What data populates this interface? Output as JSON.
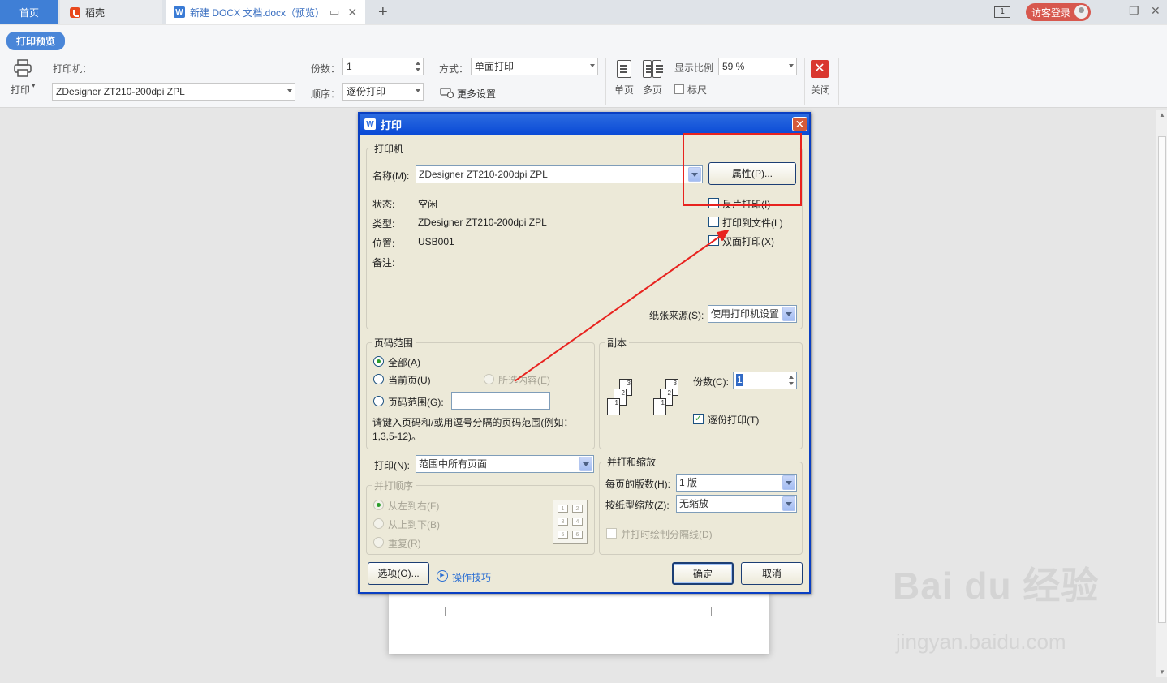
{
  "tabs": {
    "home": "首页",
    "daoke": "稻壳",
    "doc": "新建 DOCX 文档.docx（预览）",
    "new_tab": "+"
  },
  "topright": {
    "window_count": "1",
    "login": "访客登录"
  },
  "toolbar": {
    "preview_badge": "打印预览",
    "print_label": "打印",
    "printer_label": "打印机：",
    "printer_value": "ZDesigner ZT210-200dpi ZPL",
    "copies_label": "份数：",
    "copies_value": "1",
    "order_label": "顺序：",
    "order_value": "逐份打印",
    "mode_label": "方式：",
    "mode_value": "单面打印",
    "more_settings": "更多设置",
    "single_page": "单页",
    "multi_page": "多页",
    "zoom_label": "显示比例",
    "zoom_value": "59 %",
    "ruler": "标尺",
    "close": "关闭"
  },
  "dialog": {
    "title": "打印",
    "printer_group": "打印机",
    "name_label": "名称(M):",
    "name_value": "ZDesigner ZT210-200dpi ZPL",
    "properties_btn": "属性(P)...",
    "status_label": "状态:",
    "status_value": "空闲",
    "type_label": "类型:",
    "type_value": "ZDesigner ZT210-200dpi ZPL",
    "location_label": "位置:",
    "location_value": "USB001",
    "comment_label": "备注:",
    "reverse_print": "反片打印(I)",
    "print_to_file": "打印到文件(L)",
    "duplex": "双面打印(X)",
    "paper_source_label": "纸张来源(S):",
    "paper_source_value": "使用打印机设置",
    "page_range_group": "页码范围",
    "all": "全部(A)",
    "current_page": "当前页(U)",
    "selection": "所选内容(E)",
    "page_range": "页码范围(G):",
    "hint": "请键入页码和/或用逗号分隔的页码范围(例如：1,3,5-12)。",
    "copies_group": "副本",
    "copies_label": "份数(C):",
    "copies_value": "1",
    "collate": "逐份打印(T)",
    "print_label": "打印(N):",
    "print_value": "范围中所有页面",
    "nup_order_group": "并打顺序",
    "left_to_right": "从左到右(F)",
    "top_to_bottom": "从上到下(B)",
    "repeat": "重复(R)",
    "zoom_group": "并打和缩放",
    "pages_per_sheet_label": "每页的版数(H):",
    "pages_per_sheet_value": "1 版",
    "scale_label": "按纸型缩放(Z):",
    "scale_value": "无缩放",
    "draw_borders": "并打时绘制分隔线(D)",
    "options_btn": "选项(O)...",
    "tips_link": "操作技巧",
    "ok_btn": "确定",
    "cancel_btn": "取消"
  },
  "watermark": {
    "brand": "Bai du 经验",
    "url": "jingyan.baidu.com"
  },
  "colors": {
    "annotation": "#e8231f",
    "dialog_bg": "#ece9d8",
    "titlebar": "#0a4ad6"
  }
}
